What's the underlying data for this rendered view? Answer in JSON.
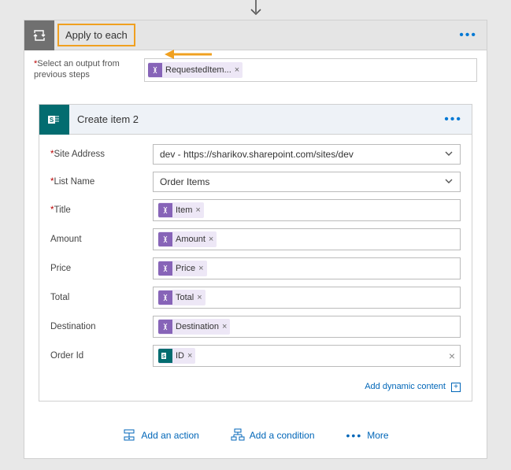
{
  "loop": {
    "title": "Apply to each",
    "select_label_prefix": "*",
    "select_label": "Select an output from previous steps",
    "select_token": "RequestedItem..."
  },
  "action": {
    "title": "Create item 2",
    "fields": {
      "site_address": {
        "label": "Site Address",
        "required": true,
        "value": "dev - https://sharikov.sharepoint.com/sites/dev"
      },
      "list_name": {
        "label": "List Name",
        "required": true,
        "value": "Order Items"
      },
      "title": {
        "label": "Title",
        "required": true,
        "token": "Item"
      },
      "amount": {
        "label": "Amount",
        "required": false,
        "token": "Amount"
      },
      "price": {
        "label": "Price",
        "required": false,
        "token": "Price"
      },
      "total": {
        "label": "Total",
        "required": false,
        "token": "Total"
      },
      "destination": {
        "label": "Destination",
        "required": false,
        "token": "Destination"
      },
      "order_id": {
        "label": "Order Id",
        "required": false,
        "token": "ID"
      }
    },
    "dynamic_link": "Add dynamic content"
  },
  "footer": {
    "add_action": "Add an action",
    "add_condition": "Add a condition",
    "more": "More"
  }
}
